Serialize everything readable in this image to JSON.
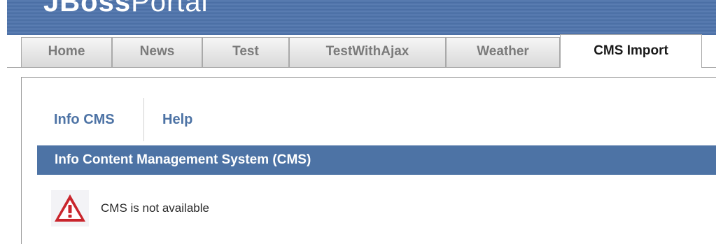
{
  "header": {
    "logo_bold": "JBoss",
    "logo_light": "Portal"
  },
  "tabs": [
    {
      "label": "Home",
      "active": false
    },
    {
      "label": "News",
      "active": false
    },
    {
      "label": "Test",
      "active": false
    },
    {
      "label": "TestWithAjax",
      "active": false
    },
    {
      "label": "Weather",
      "active": false
    },
    {
      "label": "CMS Import",
      "active": true
    }
  ],
  "portlet": {
    "tabs": [
      {
        "label": "Info CMS"
      },
      {
        "label": "Help"
      }
    ],
    "section_title": "Info Content Management System (CMS)",
    "message": "CMS is not available",
    "message_icon": "warning-triangle-icon"
  },
  "colors": {
    "header_blue": "#4b70a6",
    "accent_blue": "#4d73a5",
    "warning_red": "#c9252c"
  }
}
